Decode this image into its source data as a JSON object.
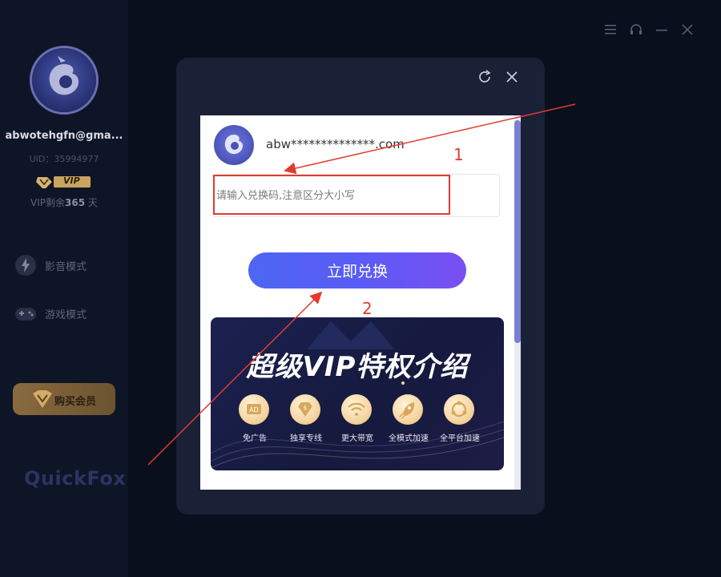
{
  "sidebar": {
    "username": "abwotehgfn@gma...",
    "uid": "UID：35994977",
    "vip_badge": "VIP",
    "vip_remain_prefix": "VIP剩余",
    "vip_remain_days": "365",
    "vip_remain_suffix": " 天",
    "nav": [
      {
        "label": "影音模式",
        "icon": "lightning-icon"
      },
      {
        "label": "游戏模式",
        "icon": "gamepad-icon"
      }
    ],
    "buy_label": "购买会员",
    "brand": "QuickFox"
  },
  "modal": {
    "email": "abw**************.com",
    "input_placeholder": "请输入兑换码,注意区分大小写",
    "input_value": "",
    "redeem_label": "立即兑换",
    "banner_title": "超级VIP特权介绍",
    "features": [
      {
        "label": "免广告",
        "icon": "ad-icon"
      },
      {
        "label": "独享专线",
        "icon": "diamond-icon"
      },
      {
        "label": "更大带宽",
        "icon": "wifi-icon"
      },
      {
        "label": "全模式加速",
        "icon": "rocket-icon"
      },
      {
        "label": "全平台加速",
        "icon": "platform-icon"
      }
    ]
  },
  "annotations": {
    "label_1": "1",
    "label_2": "2"
  },
  "colors": {
    "accent": "#5a5cf5",
    "annotation": "#e23b2e",
    "vip_gold": "#c9a35f"
  }
}
